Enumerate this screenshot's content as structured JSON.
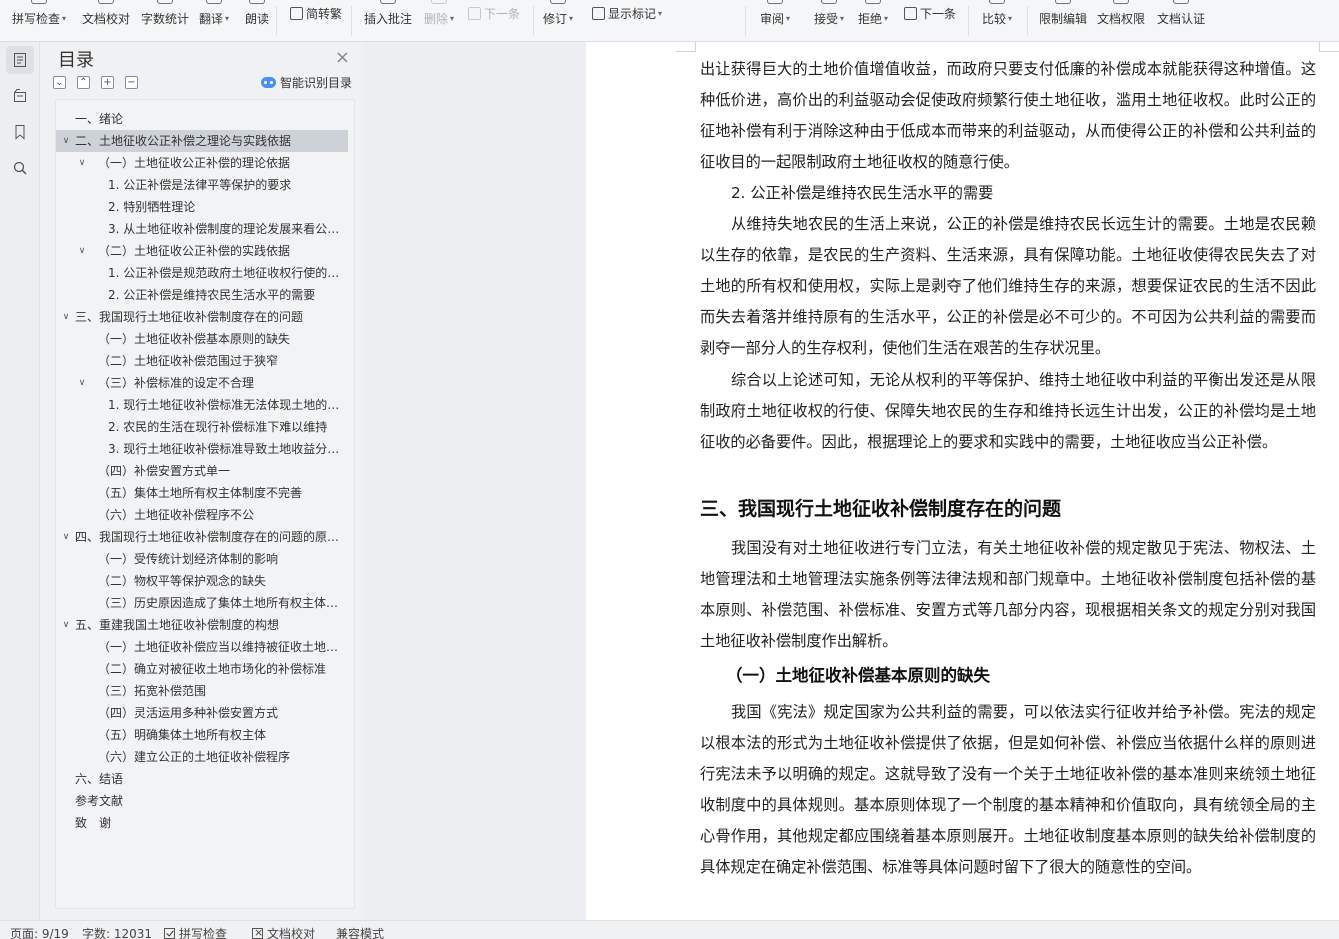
{
  "ribbon": {
    "items": [
      {
        "label": "拼写检查",
        "caret": true,
        "disabled": false
      },
      {
        "label": "文档校对",
        "caret": false,
        "disabled": false
      },
      {
        "label": "字数统计",
        "caret": false,
        "disabled": false
      },
      {
        "label": "翻译",
        "caret": true,
        "disabled": false
      },
      {
        "label": "朗读",
        "caret": false,
        "disabled": false
      },
      {
        "label": "简转繁",
        "caret": false,
        "disabled": false
      },
      {
        "label": "插入批注",
        "caret": false,
        "disabled": false
      },
      {
        "label": "删除",
        "caret": true,
        "disabled": true
      },
      {
        "label": "下一条",
        "caret": false,
        "disabled": true
      },
      {
        "label": "修订",
        "caret": true,
        "disabled": false
      },
      {
        "label": "显示标记",
        "caret": true,
        "disabled": false
      },
      {
        "label": "审阅",
        "caret": true,
        "disabled": false
      },
      {
        "label": "接受",
        "caret": true,
        "disabled": false
      },
      {
        "label": "拒绝",
        "caret": true,
        "disabled": false
      },
      {
        "label": "下一条",
        "caret": false,
        "disabled": false
      },
      {
        "label": "比较",
        "caret": true,
        "disabled": false
      },
      {
        "label": "限制编辑",
        "caret": false,
        "disabled": false
      },
      {
        "label": "文档权限",
        "caret": false,
        "disabled": false
      },
      {
        "label": "文档认证",
        "caret": false,
        "disabled": false
      }
    ]
  },
  "rail": {
    "icons": [
      "toc-icon",
      "navigation-icon",
      "bookmark-icon",
      "search-icon"
    ]
  },
  "toc": {
    "title": "目录",
    "close": "×",
    "smart_label": "智能识别目录",
    "tools": [
      "⌄",
      "⌃",
      "+",
      "−"
    ],
    "items": [
      {
        "level": 1,
        "label": "一、绪论",
        "expand": ""
      },
      {
        "level": 1,
        "label": "二、土地征收公正补偿之理论与实践依据",
        "expand": "open",
        "selected": true
      },
      {
        "level": 2,
        "label": "（一）土地征收公正补偿的理论依据",
        "expand": "open"
      },
      {
        "level": 3,
        "label": "1. 公正补偿是法律平等保护的要求",
        "expand": ""
      },
      {
        "level": 3,
        "label": "2. 特别牺牲理论",
        "expand": ""
      },
      {
        "level": 3,
        "label": "3. 从土地征收补偿制度的理论发展来看公正补偿的必要性",
        "expand": ""
      },
      {
        "level": 2,
        "label": "（二）土地征收公正补偿的实践依据",
        "expand": "open"
      },
      {
        "level": 3,
        "label": "1. 公正补偿是规范政府土地征收权行使的需要",
        "expand": ""
      },
      {
        "level": 3,
        "label": "2. 公正补偿是维持农民生活水平的需要",
        "expand": ""
      },
      {
        "level": 1,
        "label": "三、我国现行土地征收补偿制度存在的问题",
        "expand": "open"
      },
      {
        "level": 2,
        "label": "（一）土地征收补偿基本原则的缺失",
        "expand": ""
      },
      {
        "level": 2,
        "label": "（二）土地征收补偿范围过于狭窄",
        "expand": ""
      },
      {
        "level": 2,
        "label": "（三）补偿标准的设定不合理",
        "expand": "open"
      },
      {
        "level": 3,
        "label": "1. 现行土地征收补偿标准无法体现土地的市场价值",
        "expand": ""
      },
      {
        "level": 3,
        "label": "2. 农民的生活在现行补偿标准下难以维持",
        "expand": ""
      },
      {
        "level": 3,
        "label": "3. 现行土地征收补偿标准导致土地收益分配不公",
        "expand": ""
      },
      {
        "level": 2,
        "label": "（四）补偿安置方式单一",
        "expand": ""
      },
      {
        "level": 2,
        "label": "（五）集体土地所有权主体制度不完善",
        "expand": ""
      },
      {
        "level": 2,
        "label": "（六）土地征收补偿程序不公",
        "expand": ""
      },
      {
        "level": 1,
        "label": "四、我国现行土地征收补偿制度存在的问题的原因分析",
        "expand": "open"
      },
      {
        "level": 2,
        "label": "（一）受传统计划经济体制的影响",
        "expand": ""
      },
      {
        "level": 2,
        "label": "（二）物权平等保护观念的缺失",
        "expand": ""
      },
      {
        "level": 2,
        "label": "（三）历史原因造成了集体土地所有权主体的虚位",
        "expand": ""
      },
      {
        "level": 1,
        "label": "五、重建我国土地征收补偿制度的构想",
        "expand": "open"
      },
      {
        "level": 2,
        "label": "（一）土地征收补偿应当以维持被征收土地农民的生活水平为原则",
        "expand": ""
      },
      {
        "level": 2,
        "label": "（二）确立对被征收土地市场化的补偿标准",
        "expand": ""
      },
      {
        "level": 2,
        "label": "（三）拓宽补偿范围",
        "expand": ""
      },
      {
        "level": 2,
        "label": "（四）灵活运用多种补偿安置方式",
        "expand": ""
      },
      {
        "level": 2,
        "label": "（五）明确集体土地所有权主体",
        "expand": ""
      },
      {
        "level": 2,
        "label": "（六）建立公正的土地征收补偿程序",
        "expand": ""
      },
      {
        "level": 1,
        "label": "六、结语",
        "expand": ""
      },
      {
        "level": 1,
        "label": "参考文献",
        "expand": ""
      },
      {
        "level": 1,
        "label": "致　谢",
        "expand": ""
      }
    ]
  },
  "document": {
    "blocks": [
      {
        "type": "para",
        "indent": false,
        "text": "出让获得巨大的土地价值增值收益，而政府只要支付低廉的补偿成本就能获得这种增值。这种低价进，高价出的利益驱动会促使政府频繁行使土地征收，滥用土地征收权。此时公正的征地补偿有利于消除这种由于低成本而带来的利益驱动，从而使得公正的补偿和公共利益的征收目的一起限制政府土地征收权的随意行使。"
      },
      {
        "type": "para",
        "indent": true,
        "text": "2. 公正补偿是维持农民生活水平的需要"
      },
      {
        "type": "para",
        "indent": true,
        "text": "从维持失地农民的生活上来说，公正的补偿是维持农民长远生计的需要。土地是农民赖以生存的依靠，是农民的生产资料、生活来源，具有保障功能。土地征收使得农民失去了对土地的所有权和使用权，实际上是剥夺了他们维持生存的来源，想要保证农民的生活不因此而失去着落并维持原有的生活水平，公正的补偿是必不可少的。不可因为公共利益的需要而剥夺一部分人的生存权利，使他们生活在艰苦的生存状况里。"
      },
      {
        "type": "para",
        "indent": true,
        "text": "综合以上论述可知，无论从权利的平等保护、维持土地征收中利益的平衡出发还是从限制政府土地征收权的行使、保障失地农民的生存和维持长远生计出发，公正的补偿均是土地征收的必备要件。因此，根据理论上的要求和实践中的需要，土地征收应当公正补偿。"
      },
      {
        "type": "h1",
        "text": "三、我国现行土地征收补偿制度存在的问题"
      },
      {
        "type": "para",
        "indent": true,
        "text": "我国没有对土地征收进行专门立法，有关土地征收补偿的规定散见于宪法、物权法、土地管理法和土地管理法实施条例等法律法规和部门规章中。土地征收补偿制度包括补偿的基本原则、补偿范围、补偿标准、安置方式等几部分内容，现根据相关条文的规定分别对我国土地征收补偿制度作出解析。"
      },
      {
        "type": "h2",
        "text": "（一）土地征收补偿基本原则的缺失"
      },
      {
        "type": "para",
        "indent": true,
        "text": "我国《宪法》规定国家为公共利益的需要，可以依法实行征收并给予补偿。宪法的规定以根本法的形式为土地征收补偿提供了依据，但是如何补偿、补偿应当依据什么样的原则进行宪法未予以明确的规定。这就导致了没有一个关于土地征收补偿的基本准则来统领土地征收制度中的具体规则。基本原则体现了一个制度的基本精神和价值取向，具有统领全局的主心骨作用，其他规定都应围绕着基本原则展开。土地征收制度基本原则的缺失给补偿制度的具体规定在确定补偿范围、标准等具体问题时留下了很大的随意性的空间。"
      }
    ]
  },
  "status": {
    "page": "页面: 9/19",
    "words": "字数: 12031",
    "spell_check": "拼写检查",
    "doc_check": "文档校对",
    "compat": "兼容模式"
  }
}
